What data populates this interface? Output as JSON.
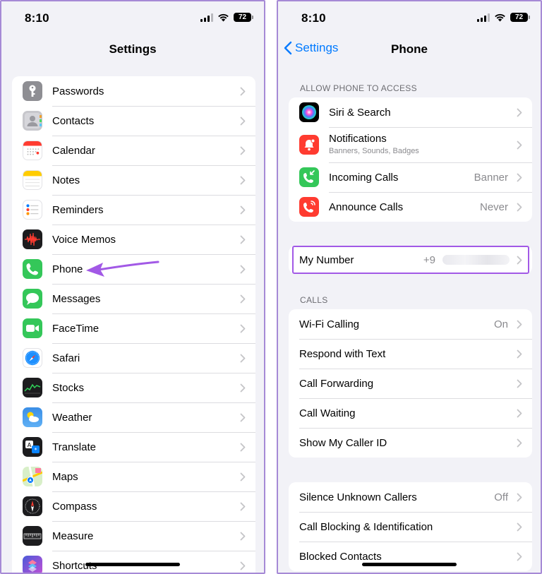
{
  "colors": {
    "accent": "#007aff",
    "highlight": "#a259e6"
  },
  "left": {
    "status": {
      "time": "8:10",
      "battery": "72"
    },
    "title": "Settings",
    "items": [
      {
        "label": "Passwords",
        "icon": "key-icon"
      },
      {
        "label": "Contacts",
        "icon": "contacts-icon"
      },
      {
        "label": "Calendar",
        "icon": "calendar-icon"
      },
      {
        "label": "Notes",
        "icon": "notes-icon"
      },
      {
        "label": "Reminders",
        "icon": "reminders-icon"
      },
      {
        "label": "Voice Memos",
        "icon": "voice-memos-icon"
      },
      {
        "label": "Phone",
        "icon": "phone-icon"
      },
      {
        "label": "Messages",
        "icon": "messages-icon"
      },
      {
        "label": "FaceTime",
        "icon": "facetime-icon"
      },
      {
        "label": "Safari",
        "icon": "safari-icon"
      },
      {
        "label": "Stocks",
        "icon": "stocks-icon"
      },
      {
        "label": "Weather",
        "icon": "weather-icon"
      },
      {
        "label": "Translate",
        "icon": "translate-icon"
      },
      {
        "label": "Maps",
        "icon": "maps-icon"
      },
      {
        "label": "Compass",
        "icon": "compass-icon"
      },
      {
        "label": "Measure",
        "icon": "measure-icon"
      },
      {
        "label": "Shortcuts",
        "icon": "shortcuts-icon"
      }
    ]
  },
  "right": {
    "status": {
      "time": "8:10",
      "battery": "72"
    },
    "back_label": "Settings",
    "title": "Phone",
    "section_access": "ALLOW PHONE TO ACCESS",
    "access": [
      {
        "label": "Siri & Search",
        "icon": "siri-icon"
      },
      {
        "label": "Notifications",
        "sub": "Banners, Sounds, Badges",
        "icon": "notifications-icon"
      },
      {
        "label": "Incoming Calls",
        "value": "Banner",
        "icon": "incoming-calls-icon"
      },
      {
        "label": "Announce Calls",
        "value": "Never",
        "icon": "announce-calls-icon"
      }
    ],
    "my_number": {
      "label": "My Number",
      "value": "+9"
    },
    "section_calls": "CALLS",
    "calls": [
      {
        "label": "Wi-Fi Calling",
        "value": "On"
      },
      {
        "label": "Respond with Text"
      },
      {
        "label": "Call Forwarding"
      },
      {
        "label": "Call Waiting"
      },
      {
        "label": "Show My Caller ID"
      }
    ],
    "blocking": [
      {
        "label": "Silence Unknown Callers",
        "value": "Off"
      },
      {
        "label": "Call Blocking & Identification"
      },
      {
        "label": "Blocked Contacts"
      }
    ]
  }
}
